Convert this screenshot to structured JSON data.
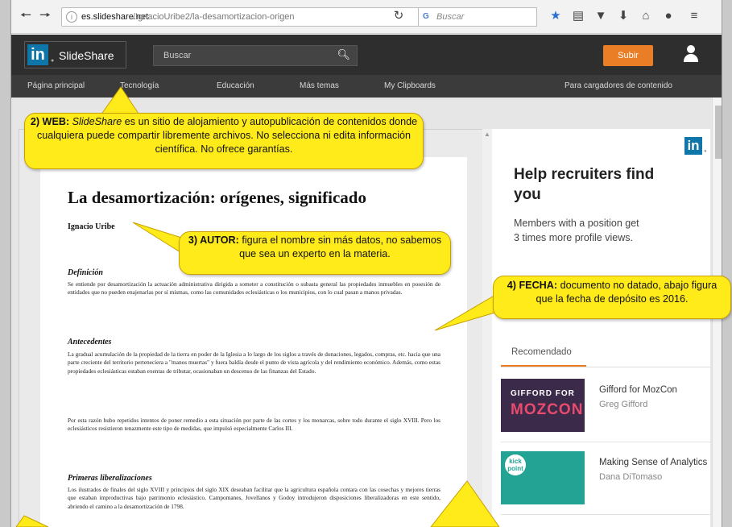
{
  "browser": {
    "back_icon": "back-arrow-icon",
    "forward_icon": "forward-arrow-icon",
    "url_host": "es.slideshare.net",
    "url_path": "/IgnacioUribe2/la-desamortizacion-origen",
    "reload_icon": "reload-icon",
    "search_placeholder": "Buscar",
    "search_engine_mark": "G"
  },
  "header": {
    "logo_mark": "in",
    "logo_text": "SlideShare",
    "search_placeholder": "Buscar",
    "upload_label": "Subir"
  },
  "nav": {
    "items": [
      "Página principal",
      "Tecnología",
      "Educación",
      "Más temas",
      "My Clipboards"
    ],
    "right_item": "Para cargadores de contenido"
  },
  "document": {
    "title": "La desamortización: orígenes, significado",
    "author": "Ignacio Uribe",
    "sections": [
      {
        "heading": "Definición",
        "text": "Se entiende por desamortización la actuación administrativa dirigida a someter a constitución o subasta general las propiedades inmuebles en posesión de entidades que no pueden enajenarlas por sí mismas, como las comunidades eclesiásticas o los municipios, con lo cual pasan a manos privadas."
      },
      {
        "heading": "Antecedentes",
        "text": "La gradual acumulación de la propiedad de la tierra en poder de la Iglesia a lo largo de los siglos a través de donaciones, legados, compras, etc. hacia que una parte creciente del territorio perteneciera a \"manos muertas\" y fuera baldía desde el punto de vista agrícola y del rendimiento económico. Además, como estas propiedades eclesiásticas estaban exentas de tributar, ocasionaban un descenso de las finanzas del Estado.",
        "text2": "Por esta razón hubo repetidos intentos de poner remedio a esta situación por parte de las cortes y los monarcas, sobre todo durante el siglo XVIII. Pero los eclesiásticos resistieron tenazmente este tipo de medidas, que impulsó especialmente Carlos III."
      },
      {
        "heading": "Primeras liberalizaciones",
        "text": "Los ilustrados de finales del siglo XVIII y principios del siglo XIX deseaban facilitar que la agricultura española contara con las cosechas y mejores tierras que estaban improductivas bajo patrimonio eclesiástico. Campomanes, Jovellanos y Godoy introdujeron disposiciones liberalizadoras en este sentido, abriendo el camino a la desamortización de 1798."
      }
    ]
  },
  "sidebar": {
    "ad_logo": "in",
    "ad_title": "Help recruiters find you",
    "ad_text": "Members with a position get 3 times more profile views.",
    "reco_title": "Recomendado",
    "items": [
      {
        "title": "Gifford for MozCon",
        "author": "Greg Gifford",
        "thumb_line1": "GIFFORD FOR",
        "thumb_line2": "MOZCON"
      },
      {
        "title": "Making Sense of Analytics",
        "author": "Dana DiTomaso",
        "thumb_logo": "kick point"
      }
    ]
  },
  "callouts": {
    "web": {
      "label": "2) WEB:",
      "name": "SlideShare",
      "text": "es un sitio de alojamiento y autopublicación de contenidos donde cualquiera puede compartir libremente archivos. No selecciona ni edita información científica. No ofrece garantías."
    },
    "autor": {
      "label": "3) AUTOR:",
      "text": "figura el nombre sin más datos, no sabemos que sea un experto en la materia."
    },
    "fecha": {
      "label": "4) FECHA:",
      "text": "documento no datado, abajo figura que la fecha de depósito es 2016."
    }
  },
  "colors": {
    "callout_fill": "#ffeb1a",
    "upload_orange": "#ea7e26",
    "linkedin_blue": "#0e76a8"
  }
}
